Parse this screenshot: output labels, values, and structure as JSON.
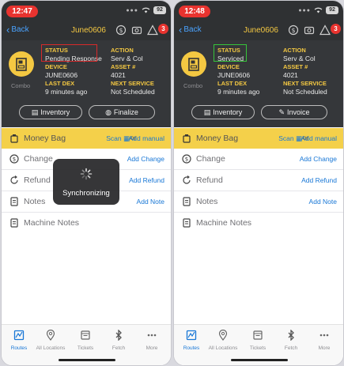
{
  "left": {
    "time": "12:47",
    "battery": "92",
    "nav": {
      "back": "Back",
      "title": "June0606",
      "badge_count": "3"
    },
    "info": {
      "status_label": "STATUS",
      "status_value": "Pending Response",
      "device_label": "DEVICE",
      "device_value": "JUNE0606",
      "last_dex_label": "LAST DEX",
      "last_dex_value": "9 minutes ago",
      "action_label": "ACTION",
      "action_value": "Serv & Col",
      "asset_label": "ASSET #",
      "asset_value": "4021",
      "next_service_label": "NEXT SERVICE",
      "next_service_value": "Not Scheduled",
      "machine_label": "Combo"
    },
    "buttons": {
      "inventory": "Inventory",
      "second": "Finalize"
    },
    "rows": {
      "money_bag": "Money Bag",
      "scan": "Scan",
      "or": "or",
      "add_manual": "Add manual",
      "change": "Change",
      "add_change": "Add Change",
      "refund": "Refund",
      "add_refund": "Add Refund",
      "notes": "Notes",
      "add_note": "Add Note",
      "machine_notes": "Machine Notes"
    },
    "sync_text": "Synchronizing"
  },
  "right": {
    "time": "12:48",
    "battery": "92",
    "nav": {
      "back": "Back",
      "title": "June0606",
      "badge_count": "3"
    },
    "info": {
      "status_label": "STATUS",
      "status_value": "Serviced",
      "device_label": "DEVICE",
      "device_value": "JUNE0606",
      "last_dex_label": "LAST DEX",
      "last_dex_value": "9 minutes ago",
      "action_label": "ACTION",
      "action_value": "Serv & Col",
      "asset_label": "ASSET #",
      "asset_value": "4021",
      "next_service_label": "NEXT SERVICE",
      "next_service_value": "Not Scheduled",
      "machine_label": "Combo"
    },
    "buttons": {
      "inventory": "Inventory",
      "second": "Invoice"
    },
    "rows": {
      "money_bag": "Money Bag",
      "scan": "Scan",
      "or": "or",
      "add_manual": "Add manual",
      "change": "Change",
      "add_change": "Add Change",
      "refund": "Refund",
      "add_refund": "Add Refund",
      "notes": "Notes",
      "add_note": "Add Note",
      "machine_notes": "Machine Notes"
    }
  },
  "tabs": [
    "Routes",
    "All Locations",
    "Tickets",
    "Fetch",
    "More"
  ],
  "colors": {
    "accent": "#1877d6",
    "brand_yellow": "#f4c842",
    "status_red": "#d8292a",
    "status_green": "#36c43a",
    "badge_red": "#e8332f"
  }
}
